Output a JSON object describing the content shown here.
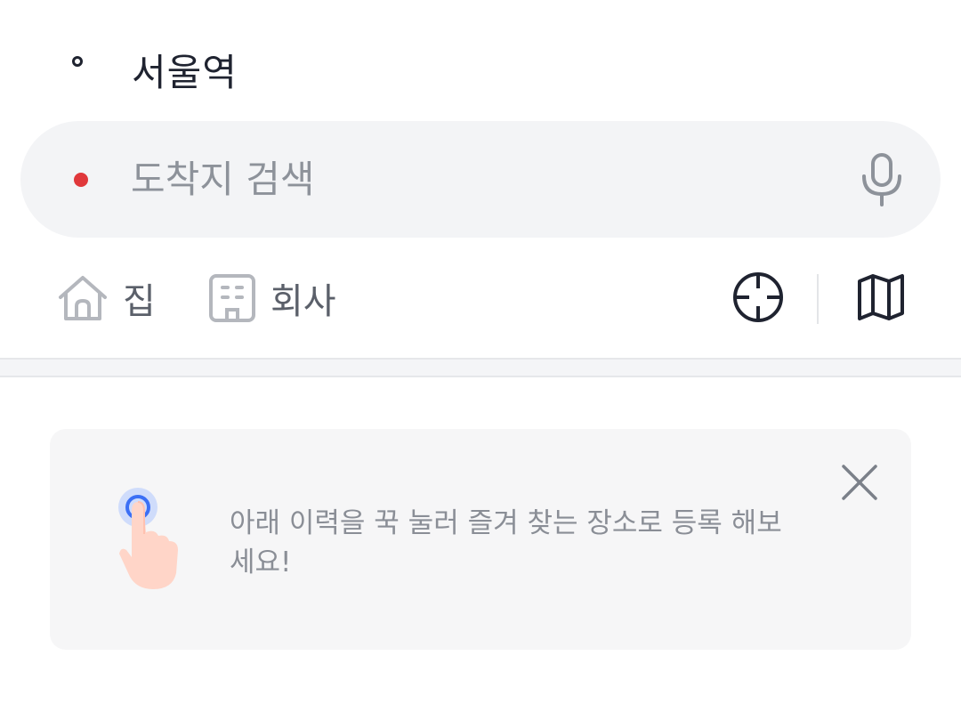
{
  "origin": {
    "label": "서울역"
  },
  "destination": {
    "placeholder": "도착지 검색",
    "mic_icon": "microphone-icon"
  },
  "shortcuts": [
    {
      "label": "집",
      "icon": "home-icon"
    },
    {
      "label": "회사",
      "icon": "office-building-icon"
    }
  ],
  "tools": {
    "current_location_icon": "crosshair-icon",
    "map_icon": "map-icon"
  },
  "tip": {
    "text": "아래 이력을 꾹 눌러 즐겨 찾는 장소로 등록 해보세요!",
    "illustration": "tap-hand-icon",
    "close_icon": "close-icon"
  },
  "colors": {
    "text_primary": "#1f2330",
    "text_secondary": "#5b606a",
    "placeholder": "#8d929a",
    "search_bg": "#f3f4f6",
    "destination_dot": "#e0383b",
    "tip_bg": "#f6f6f7",
    "tap_ring": "#3b6ff5",
    "hand_skin": "#ffd5c8"
  }
}
